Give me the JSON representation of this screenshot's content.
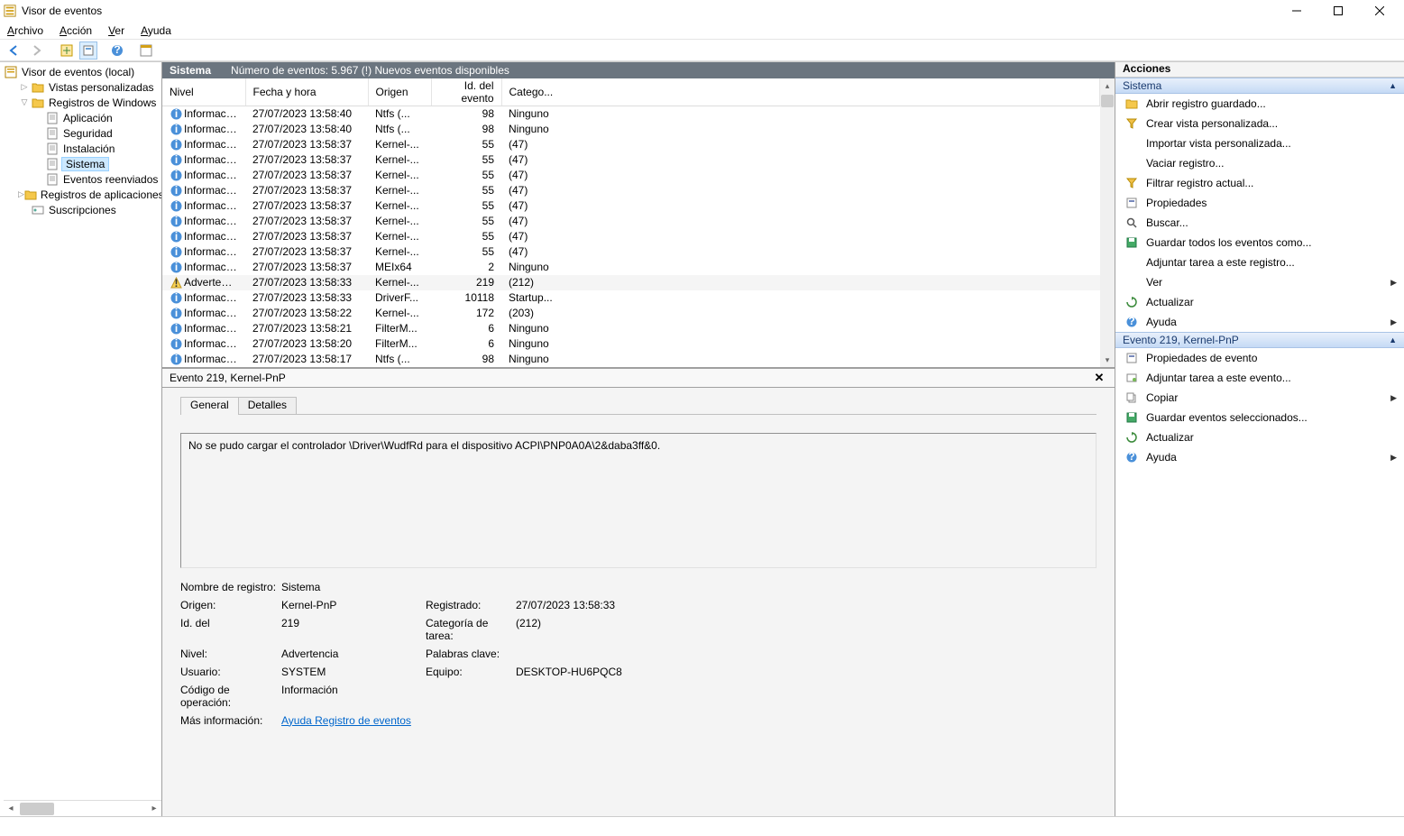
{
  "window": {
    "title": "Visor de eventos"
  },
  "menu": [
    "Archivo",
    "Acción",
    "Ver",
    "Ayuda"
  ],
  "tree": {
    "root": "Visor de eventos (local)",
    "items": [
      {
        "label": "Vistas personalizadas",
        "depth": 1,
        "expander": "▷",
        "icon": "folder"
      },
      {
        "label": "Registros de Windows",
        "depth": 1,
        "expander": "▽",
        "icon": "folder"
      },
      {
        "label": "Aplicación",
        "depth": 2,
        "icon": "log"
      },
      {
        "label": "Seguridad",
        "depth": 2,
        "icon": "log"
      },
      {
        "label": "Instalación",
        "depth": 2,
        "icon": "log"
      },
      {
        "label": "Sistema",
        "depth": 2,
        "icon": "log",
        "selected": true
      },
      {
        "label": "Eventos reenviados",
        "depth": 2,
        "icon": "log"
      },
      {
        "label": "Registros de aplicaciones y servicios",
        "depth": 1,
        "expander": "▷",
        "icon": "folder"
      },
      {
        "label": "Suscripciones",
        "depth": 1,
        "icon": "sub"
      }
    ]
  },
  "logHeader": {
    "name": "Sistema",
    "count": "Número de eventos: 5.967 (!) Nuevos eventos disponibles"
  },
  "columns": [
    "Nivel",
    "Fecha y hora",
    "Origen",
    "Id. del evento",
    "Catego..."
  ],
  "events": [
    {
      "lvl": "Información",
      "dt": "27/07/2023 13:58:40",
      "src": "Ntfs (...",
      "id": "98",
      "cat": "Ninguno"
    },
    {
      "lvl": "Información",
      "dt": "27/07/2023 13:58:40",
      "src": "Ntfs (...",
      "id": "98",
      "cat": "Ninguno"
    },
    {
      "lvl": "Información",
      "dt": "27/07/2023 13:58:37",
      "src": "Kernel-...",
      "id": "55",
      "cat": "(47)"
    },
    {
      "lvl": "Información",
      "dt": "27/07/2023 13:58:37",
      "src": "Kernel-...",
      "id": "55",
      "cat": "(47)"
    },
    {
      "lvl": "Información",
      "dt": "27/07/2023 13:58:37",
      "src": "Kernel-...",
      "id": "55",
      "cat": "(47)"
    },
    {
      "lvl": "Información",
      "dt": "27/07/2023 13:58:37",
      "src": "Kernel-...",
      "id": "55",
      "cat": "(47)"
    },
    {
      "lvl": "Información",
      "dt": "27/07/2023 13:58:37",
      "src": "Kernel-...",
      "id": "55",
      "cat": "(47)"
    },
    {
      "lvl": "Información",
      "dt": "27/07/2023 13:58:37",
      "src": "Kernel-...",
      "id": "55",
      "cat": "(47)"
    },
    {
      "lvl": "Información",
      "dt": "27/07/2023 13:58:37",
      "src": "Kernel-...",
      "id": "55",
      "cat": "(47)"
    },
    {
      "lvl": "Información",
      "dt": "27/07/2023 13:58:37",
      "src": "Kernel-...",
      "id": "55",
      "cat": "(47)"
    },
    {
      "lvl": "Información",
      "dt": "27/07/2023 13:58:37",
      "src": "MEIx64",
      "id": "2",
      "cat": "Ninguno"
    },
    {
      "lvl": "Advertencia",
      "dt": "27/07/2023 13:58:33",
      "src": "Kernel-...",
      "id": "219",
      "cat": "(212)",
      "selected": true
    },
    {
      "lvl": "Información",
      "dt": "27/07/2023 13:58:33",
      "src": "DriverF...",
      "id": "10118",
      "cat": "Startup..."
    },
    {
      "lvl": "Información",
      "dt": "27/07/2023 13:58:22",
      "src": "Kernel-...",
      "id": "172",
      "cat": "(203)"
    },
    {
      "lvl": "Información",
      "dt": "27/07/2023 13:58:21",
      "src": "FilterM...",
      "id": "6",
      "cat": "Ninguno"
    },
    {
      "lvl": "Información",
      "dt": "27/07/2023 13:58:20",
      "src": "FilterM...",
      "id": "6",
      "cat": "Ninguno"
    },
    {
      "lvl": "Información",
      "dt": "27/07/2023 13:58:17",
      "src": "Ntfs (...",
      "id": "98",
      "cat": "Ninguno"
    }
  ],
  "detail": {
    "header": "Evento 219, Kernel-PnP",
    "tabs": [
      "General",
      "Detalles"
    ],
    "message": "No se pudo cargar el controlador \\Driver\\WudfRd para el dispositivo ACPI\\PNP0A0A\\2&daba3ff&0.",
    "fields": {
      "log_label": "Nombre de registro:",
      "log": "Sistema",
      "src_label": "Origen:",
      "src": "Kernel-PnP",
      "logged_label": "Registrado:",
      "logged": "27/07/2023 13:58:33",
      "id_label": "Id. del",
      "id": "219",
      "taskcat_label": "Categoría de tarea:",
      "taskcat": "(212)",
      "level_label": "Nivel:",
      "level": "Advertencia",
      "keywords_label": "Palabras clave:",
      "keywords": "",
      "user_label": "Usuario:",
      "user": "SYSTEM",
      "computer_label": "Equipo:",
      "computer": "DESKTOP-HU6PQC8",
      "opcode_label": "Código de operación:",
      "opcode": "Información",
      "more_label": "Más información:",
      "more_link": "Ayuda Registro de eventos"
    }
  },
  "actions": {
    "title": "Acciones",
    "section1": "Sistema",
    "group1": [
      {
        "icon": "open",
        "label": "Abrir registro guardado..."
      },
      {
        "icon": "filter",
        "label": "Crear vista personalizada..."
      },
      {
        "icon": "",
        "label": "Importar vista personalizada..."
      },
      {
        "icon": "",
        "label": "Vaciar registro..."
      },
      {
        "icon": "filter",
        "label": "Filtrar registro actual..."
      },
      {
        "icon": "props",
        "label": "Propiedades"
      },
      {
        "icon": "find",
        "label": "Buscar..."
      },
      {
        "icon": "save",
        "label": "Guardar todos los eventos como..."
      },
      {
        "icon": "",
        "label": "Adjuntar tarea a este registro..."
      },
      {
        "icon": "",
        "label": "Ver",
        "arrow": true
      },
      {
        "icon": "refresh",
        "label": "Actualizar"
      },
      {
        "icon": "help",
        "label": "Ayuda",
        "arrow": true
      }
    ],
    "section2": "Evento 219, Kernel-PnP",
    "group2": [
      {
        "icon": "props",
        "label": "Propiedades de evento"
      },
      {
        "icon": "task",
        "label": "Adjuntar tarea a este evento..."
      },
      {
        "icon": "copy",
        "label": "Copiar",
        "arrow": true
      },
      {
        "icon": "save",
        "label": "Guardar eventos seleccionados..."
      },
      {
        "icon": "refresh",
        "label": "Actualizar"
      },
      {
        "icon": "help",
        "label": "Ayuda",
        "arrow": true
      }
    ]
  }
}
